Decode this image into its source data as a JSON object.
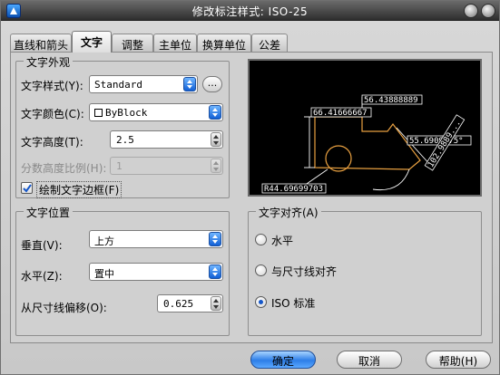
{
  "window": {
    "title": "修改标注样式: ISO-25"
  },
  "tabs": [
    {
      "label": "直线和箭头"
    },
    {
      "label": "文字"
    },
    {
      "label": "调整"
    },
    {
      "label": "主单位"
    },
    {
      "label": "换算单位"
    },
    {
      "label": "公差"
    }
  ],
  "appearance": {
    "group_title": "文字外观",
    "style_label": "文字样式(Y):",
    "style_value": "Standard",
    "style_browse": "...",
    "color_label": "文字颜色(C):",
    "color_value": "ByBlock",
    "height_label": "文字高度(T):",
    "height_value": "2.5",
    "fraction_label": "分数高度比例(H):",
    "fraction_value": "1",
    "frame_label": "绘制文字边框(F)",
    "frame_checked": true
  },
  "placement": {
    "group_title": "文字位置",
    "vertical_label": "垂直(V):",
    "vertical_value": "上方",
    "horizontal_label": "水平(Z):",
    "horizontal_value": "置中",
    "offset_label": "从尺寸线偏移(O):",
    "offset_value": "0.625"
  },
  "alignment": {
    "group_title": "文字对齐(A)",
    "options": [
      {
        "label": "水平",
        "selected": false
      },
      {
        "label": "与尺寸线对齐",
        "selected": false
      },
      {
        "label": "ISO 标准",
        "selected": true
      }
    ]
  },
  "preview": {
    "dim_top": "56.43888889",
    "dim_left": "66.41666667",
    "dim_angle": "55.6909075°",
    "dim_diag": "102.9889...",
    "dim_bottom": "R44.69699703",
    "colors": {
      "geometry": "#e8a040",
      "dimension": "#ffffff",
      "background": "#000000"
    }
  },
  "buttons": {
    "ok": "确定",
    "cancel": "取消",
    "help": "帮助(H)"
  },
  "colors": {
    "accent_blue": "#2d7ee8",
    "window_bg": "#c8c8c8"
  }
}
